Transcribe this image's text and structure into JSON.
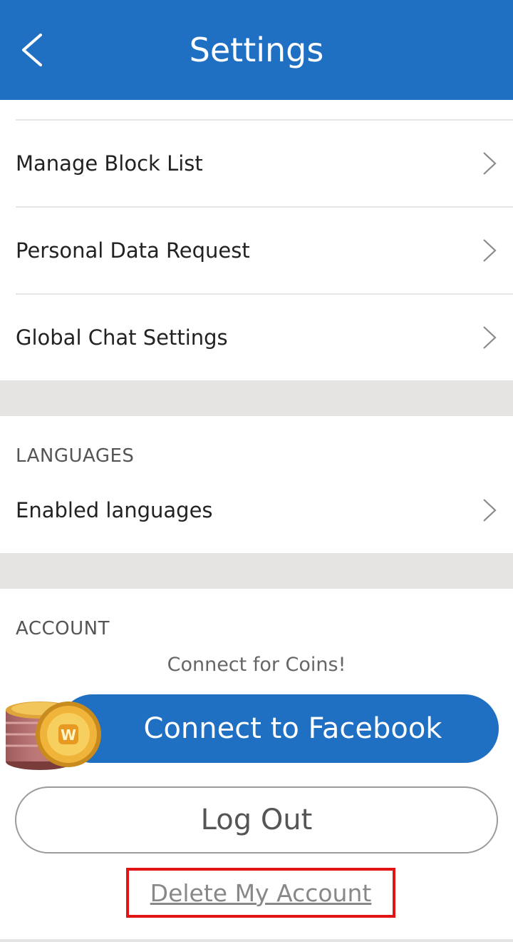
{
  "header": {
    "title": "Settings"
  },
  "privacy_rows": [
    {
      "label": "Manage Block List"
    },
    {
      "label": "Personal Data Request"
    },
    {
      "label": "Global Chat Settings"
    }
  ],
  "languages": {
    "heading": "LANGUAGES",
    "row_label": "Enabled languages"
  },
  "account": {
    "heading": "ACCOUNT",
    "connect_note": "Connect for Coins!",
    "facebook_button": "Connect to Facebook",
    "logout_button": "Log Out",
    "delete_link": "Delete My Account"
  },
  "colors": {
    "brand_blue": "#1f6fc3",
    "highlight_red": "#e01414"
  }
}
